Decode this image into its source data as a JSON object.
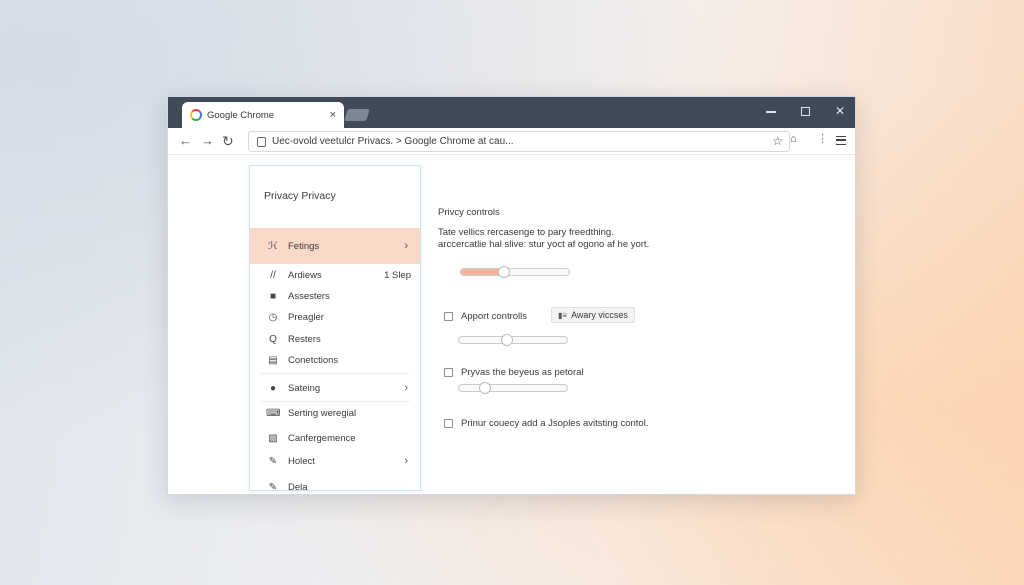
{
  "window": {
    "tab_title": "Google Chrome",
    "tab_close": "×",
    "url": "Uec-ovold veetulcr Privacs. > Google Chrome at cau..."
  },
  "nav": {
    "back": "←",
    "forward": "→",
    "reload": "↻",
    "star": "☆",
    "ext": "⌂",
    "kebab": "⋮"
  },
  "sidebar": {
    "title": "Privacy Privacy",
    "items": [
      {
        "label": "Fetings",
        "icon": "wrench-icon",
        "glyph": "ℋ",
        "chevron": "›"
      },
      {
        "label": "Ardiews",
        "icon": "pen-icon",
        "glyph": "//",
        "meta": "1 Slep"
      },
      {
        "label": "Assesters",
        "icon": "briefcase-icon",
        "glyph": "■"
      },
      {
        "label": "Preagler",
        "icon": "clock-icon",
        "glyph": "◷"
      },
      {
        "label": "Resters",
        "icon": "search-icon",
        "glyph": "Q"
      },
      {
        "label": "Conetctions",
        "icon": "grid-icon",
        "glyph": "▤"
      },
      {
        "label": "Sateing",
        "icon": "compass-icon",
        "glyph": "●",
        "chevron": "›"
      },
      {
        "label": "Serting weregial",
        "icon": "keyboard-icon",
        "glyph": "⌨"
      },
      {
        "label": "Canfergemence",
        "icon": "document-icon",
        "glyph": "▧"
      },
      {
        "label": "Holect",
        "icon": "pencil-icon",
        "glyph": "✎",
        "chevron": "›"
      },
      {
        "label": "Dela",
        "icon": "tag-icon",
        "glyph": "✎"
      }
    ]
  },
  "privacy": {
    "title": "Privcy controls",
    "desc_line1": "Tate vellics rercasenge to pary freedthing.",
    "desc_line2": "arccercatlie hal slive: stur yoct af ogono af he yort.",
    "slider1": 0.4,
    "option1": "Apport controlls",
    "chip": "Awary viccses",
    "slider2": 0.44,
    "option2": "Pryvas the beyeus as petoral",
    "slider3": 0.24,
    "option3": "Prinur couecy add a Jsoples avitsting contol."
  },
  "colors": {
    "titlebar": "#3f4b59",
    "accent": "#fbd9c9",
    "slider_fill": "#f4b69a"
  }
}
